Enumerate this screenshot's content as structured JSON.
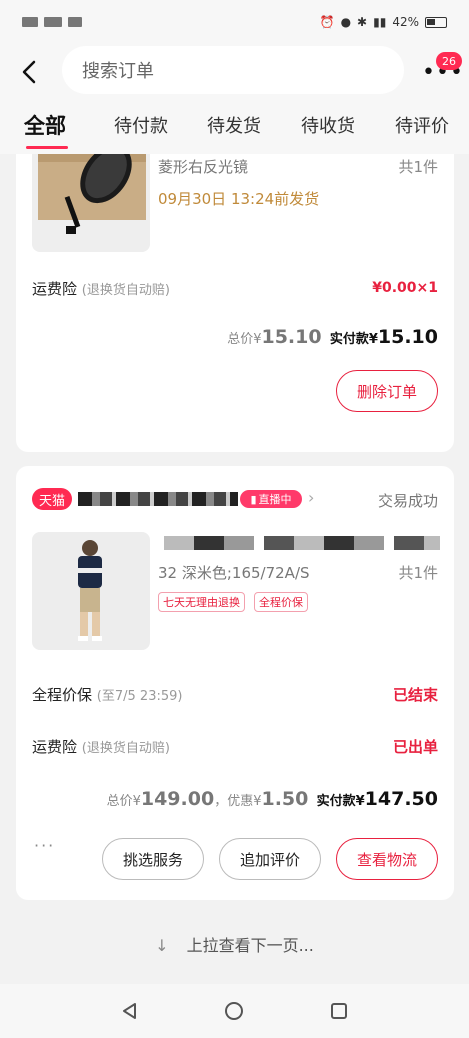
{
  "status_bar": {
    "battery": "42%"
  },
  "header": {
    "search_placeholder": "搜索订单",
    "badge_count": "26"
  },
  "tabs": [
    {
      "label": "全部",
      "active": true
    },
    {
      "label": "待付款"
    },
    {
      "label": "待发货"
    },
    {
      "label": "待收货"
    },
    {
      "label": "待评价"
    }
  ],
  "order1": {
    "spec": "菱形右反光镜",
    "qty": "共1件",
    "ship_notice": "09月30日 13:24前发货",
    "insurance_label": "运费险",
    "insurance_sub": "(退换货自动赔)",
    "insurance_value": "¥0.00×1",
    "total_label": "总价¥",
    "total_value": "15.10",
    "paid_label": "实付款¥",
    "paid_value": "15.10",
    "delete_button": "删除订单"
  },
  "order2": {
    "store_badge": "天猫",
    "live_badge": "直播中",
    "status": "交易成功",
    "spec": "32 深米色;165/72A/S",
    "qty": "共1件",
    "tags": [
      "七天无理由退换",
      "全程价保"
    ],
    "price_protect_label": "全程价保",
    "price_protect_sub": "(至7/5 23:59)",
    "price_protect_value": "已结束",
    "insurance_label": "运费险",
    "insurance_sub": "(退换货自动赔)",
    "insurance_value": "已出单",
    "total_label": "总价¥",
    "total_value": "149.00",
    "discount_label": "，优惠¥",
    "discount_value": "1.50",
    "paid_label": "实付款¥",
    "paid_value": "147.50",
    "more": "···",
    "buttons": [
      "挑选服务",
      "追加评价",
      "查看物流"
    ]
  },
  "footer_hint": "上拉查看下一页...",
  "colors": {
    "accent": "#e8213f",
    "ship": "#c08a3a",
    "bg": "#f2f2f2"
  }
}
